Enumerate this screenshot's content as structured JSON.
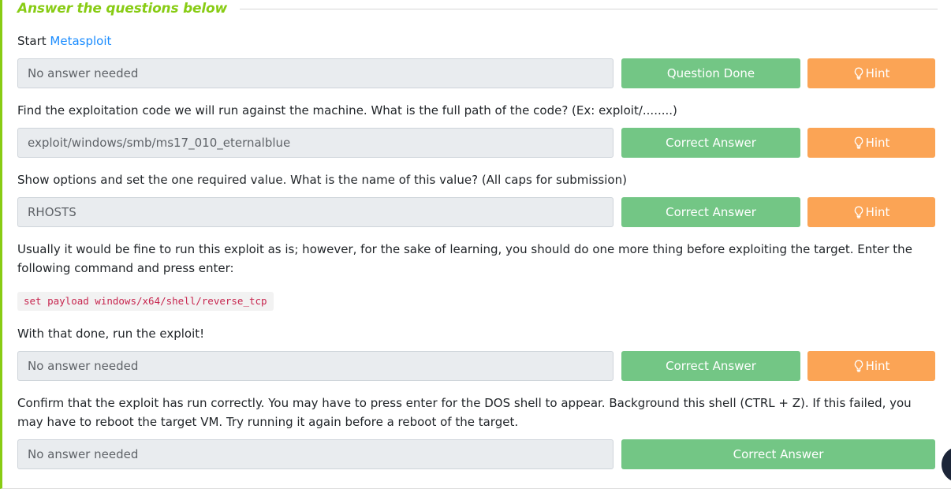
{
  "task": {
    "heading": "Answer the questions below"
  },
  "questions": [
    {
      "text_prefix": "Start ",
      "text_link": "Metasploit",
      "answer": "No answer needed",
      "submit_label": "Question Done",
      "hint_label": "Hint"
    },
    {
      "text": "Find the exploitation code we will run against the machine. What is the full path of the code? (Ex: exploit/........)",
      "answer": "exploit/windows/smb/ms17_010_eternalblue",
      "submit_label": "Correct Answer",
      "hint_label": "Hint"
    },
    {
      "text": "Show options and set the one required value. What is the name of this value? (All caps for submission)",
      "answer": "RHOSTS",
      "submit_label": "Correct Answer",
      "hint_label": "Hint"
    },
    {
      "text": "Usually it would be fine to run this exploit as is; however, for the sake of learning, you should do one more thing before exploiting the target. Enter the following command and press enter:",
      "code": "set payload windows/x64/shell/reverse_tcp",
      "text_after": "With that done, run the exploit!",
      "answer": "No answer needed",
      "submit_label": "Correct Answer",
      "hint_label": "Hint"
    },
    {
      "text": "Confirm that the exploit has run correctly. You may have to press enter for the DOS shell to appear. Background this shell (CTRL + Z). If this failed, you may have to reboot the target VM. Try running it again before a reboot of the target.",
      "answer": "No answer needed",
      "submit_label": "Correct Answer"
    }
  ],
  "icons": {
    "hint": "lightbulb-icon"
  },
  "colors": {
    "accent": "#88cc14",
    "success": "#73c685",
    "hint": "#fba455",
    "link": "#1a8cff",
    "code": "#c7254e",
    "input_bg": "#e9ecef"
  }
}
